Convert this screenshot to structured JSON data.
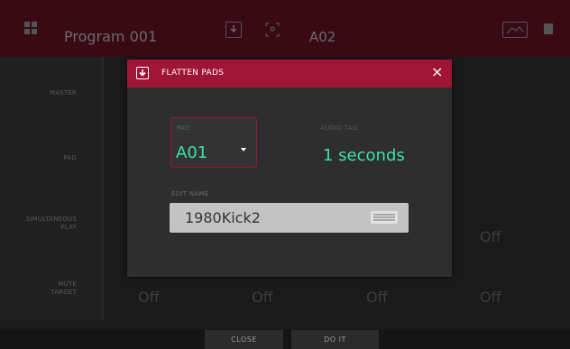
{
  "header": {
    "program": "Program 001",
    "pad_name": "A02"
  },
  "rows": {
    "master": "MASTER",
    "pad": "PAD",
    "simultaneous_play": [
      "SIMULTANEOUS",
      "PLAY"
    ],
    "mute_target": [
      "MUTE",
      "TARGET"
    ]
  },
  "background_values": {
    "simultaneous_play_right": "Off",
    "mute_target": [
      "Off",
      "Off",
      "Off",
      "Off"
    ]
  },
  "modal": {
    "title": "FLATTEN PADS",
    "pad_label": "PAD",
    "pad_value": "A01",
    "audio_tail_label": "AUDIO TAIL",
    "audio_tail_value": "1 seconds",
    "edit_name_label": "EDIT NAME",
    "edit_name_value": "1980Kick2"
  },
  "footer": {
    "close_label": "CLOSE",
    "do_it_label": "DO IT"
  },
  "colors": {
    "accent": "#a01535",
    "value_green": "#3ee0a7"
  },
  "icons": {
    "flatten": "arrow-down-box-icon",
    "close": "close-icon",
    "keyboard": "keyboard-icon",
    "dropdown": "caret-down-icon"
  }
}
